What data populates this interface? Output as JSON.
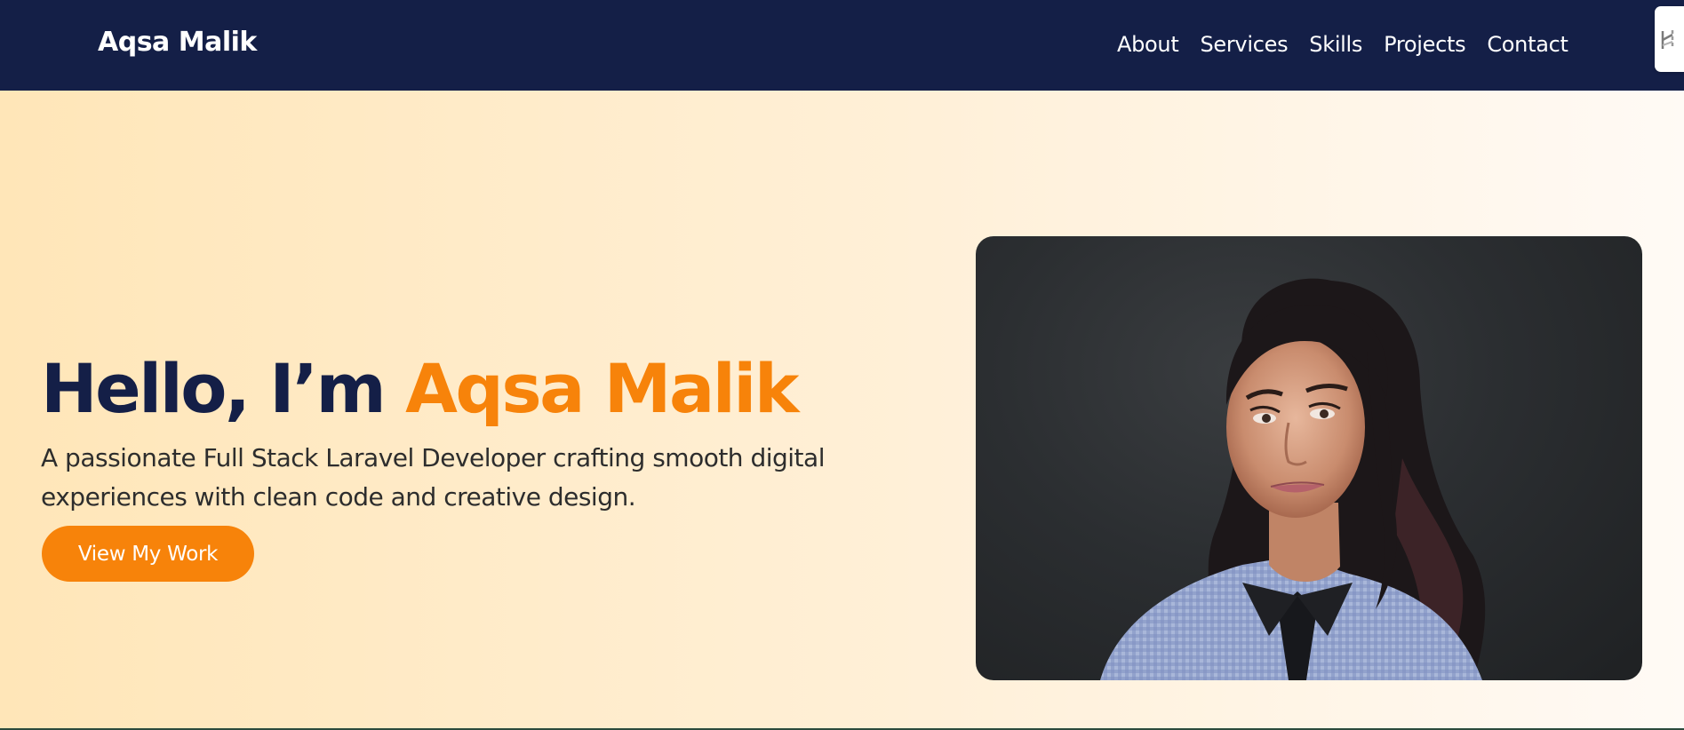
{
  "navbar": {
    "brand": "Aqsa Malik",
    "links": [
      {
        "label": "About"
      },
      {
        "label": "Services"
      },
      {
        "label": "Skills"
      },
      {
        "label": "Projects"
      },
      {
        "label": "Contact"
      }
    ],
    "background_color": "#141f47"
  },
  "hero": {
    "greeting": "Hello, I’m",
    "name": "Aqsa Malik",
    "subtitle": "A passionate Full Stack Laravel Developer crafting smooth digital experiences with clean code and creative design.",
    "cta_label": "View My Work",
    "accent_color": "#f7830a",
    "photo": "portrait-photo"
  },
  "side_widget": {
    "icon": "extension-icon"
  }
}
